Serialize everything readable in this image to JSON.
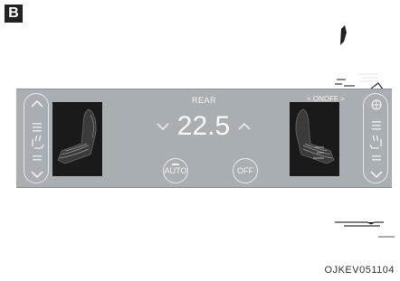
{
  "figure": {
    "badge": "B",
    "code": "OJKEV051104"
  },
  "panel": {
    "title": "REAR",
    "mode_label": "< ONOFF >",
    "temperature": "22.5",
    "auto_label": "AUTO",
    "off_label": "OFF"
  }
}
